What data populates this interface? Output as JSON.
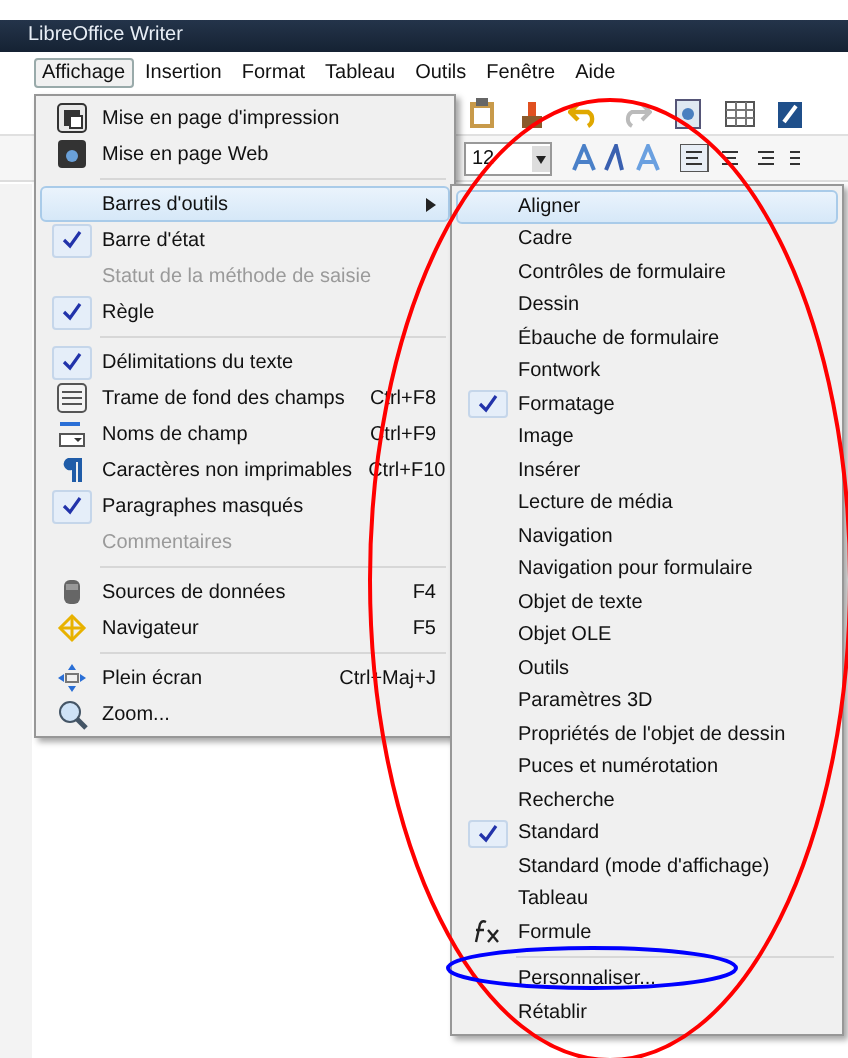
{
  "window": {
    "title": "LibreOffice Writer"
  },
  "menubar": [
    {
      "label": "Affichage",
      "selected": true
    },
    {
      "label": "Insertion",
      "selected": false
    },
    {
      "label": "Format",
      "selected": false
    },
    {
      "label": "Tableau",
      "selected": false
    },
    {
      "label": "Outils",
      "selected": false
    },
    {
      "label": "Fenêtre",
      "selected": false
    },
    {
      "label": "Aide",
      "selected": false
    }
  ],
  "toolbar": {
    "font_size": "12"
  },
  "view_menu": [
    [
      {
        "label": "Mise en page d'impression",
        "kind": "icon",
        "checked": false,
        "disabled": false,
        "selected": false
      },
      {
        "label": "Mise en page Web",
        "kind": "icon",
        "checked": false,
        "disabled": false,
        "selected": false
      }
    ],
    [
      {
        "label": "Barres d'outils",
        "kind": "submenu",
        "checked": false,
        "disabled": false,
        "selected": true
      },
      {
        "label": "Barre d'état",
        "kind": "check",
        "checked": true,
        "disabled": false,
        "selected": false
      },
      {
        "label": "Statut de la méthode de saisie",
        "kind": "check",
        "checked": false,
        "disabled": true,
        "selected": false
      },
      {
        "label": "Règle",
        "kind": "check",
        "checked": true,
        "disabled": false,
        "selected": false
      }
    ],
    [
      {
        "label": "Délimitations du texte",
        "kind": "check",
        "checked": true,
        "disabled": false,
        "selected": false
      },
      {
        "label": "Trame de fond des champs",
        "shortcut": "Ctrl+F8",
        "kind": "icon",
        "checked": false,
        "disabled": false,
        "selected": false
      },
      {
        "label": "Noms de champ",
        "shortcut": "Ctrl+F9",
        "kind": "icon",
        "checked": false,
        "disabled": false,
        "selected": false
      },
      {
        "label": "Caractères non imprimables",
        "shortcut": "Ctrl+F10",
        "kind": "icon",
        "checked": false,
        "disabled": false,
        "selected": false
      },
      {
        "label": "Paragraphes masqués",
        "kind": "check",
        "checked": true,
        "disabled": false,
        "selected": false
      },
      {
        "label": "Commentaires",
        "kind": "check",
        "checked": false,
        "disabled": true,
        "selected": false
      }
    ],
    [
      {
        "label": "Sources de données",
        "shortcut": "F4",
        "kind": "icon",
        "checked": false,
        "disabled": false,
        "selected": false
      },
      {
        "label": "Navigateur",
        "shortcut": "F5",
        "kind": "icon",
        "checked": false,
        "disabled": false,
        "selected": false
      }
    ],
    [
      {
        "label": "Plein écran",
        "shortcut": "Ctrl+Maj+J",
        "kind": "icon",
        "checked": false,
        "disabled": false,
        "selected": false
      },
      {
        "label": "Zoom...",
        "kind": "icon",
        "checked": false,
        "disabled": false,
        "selected": false
      }
    ]
  ],
  "toolbars_submenu": [
    [
      {
        "label": "Aligner",
        "checked": false,
        "selected": true
      },
      {
        "label": "Cadre",
        "checked": false,
        "selected": false
      },
      {
        "label": "Contrôles de formulaire",
        "checked": false,
        "selected": false
      },
      {
        "label": "Dessin",
        "checked": false,
        "selected": false
      },
      {
        "label": "Ébauche de formulaire",
        "checked": false,
        "selected": false
      },
      {
        "label": "Fontwork",
        "checked": false,
        "selected": false
      },
      {
        "label": "Formatage",
        "checked": true,
        "selected": false
      },
      {
        "label": "Image",
        "checked": false,
        "selected": false
      },
      {
        "label": "Insérer",
        "checked": false,
        "selected": false
      },
      {
        "label": "Lecture de média",
        "checked": false,
        "selected": false
      },
      {
        "label": "Navigation",
        "checked": false,
        "selected": false
      },
      {
        "label": "Navigation pour formulaire",
        "checked": false,
        "selected": false
      },
      {
        "label": "Objet de texte",
        "checked": false,
        "selected": false
      },
      {
        "label": "Objet OLE",
        "checked": false,
        "selected": false
      },
      {
        "label": "Outils",
        "checked": false,
        "selected": false
      },
      {
        "label": "Paramètres 3D",
        "checked": false,
        "selected": false
      },
      {
        "label": "Propriétés de l'objet de dessin",
        "checked": false,
        "selected": false
      },
      {
        "label": "Puces et numérotation",
        "checked": false,
        "selected": false
      },
      {
        "label": "Recherche",
        "checked": false,
        "selected": false
      },
      {
        "label": "Standard",
        "checked": true,
        "selected": false
      },
      {
        "label": "Standard (mode d'affichage)",
        "checked": false,
        "selected": false
      },
      {
        "label": "Tableau",
        "checked": false,
        "selected": false
      },
      {
        "label": "Formule",
        "kind": "icon",
        "checked": false,
        "selected": false
      }
    ],
    [
      {
        "label": "Personnaliser...",
        "checked": false,
        "selected": false
      },
      {
        "label": "Rétablir",
        "checked": false,
        "selected": false
      }
    ]
  ],
  "annotations": [
    {
      "kind": "ellipse",
      "color": "#ff0000"
    },
    {
      "kind": "ellipse",
      "color": "#0000ff"
    }
  ]
}
